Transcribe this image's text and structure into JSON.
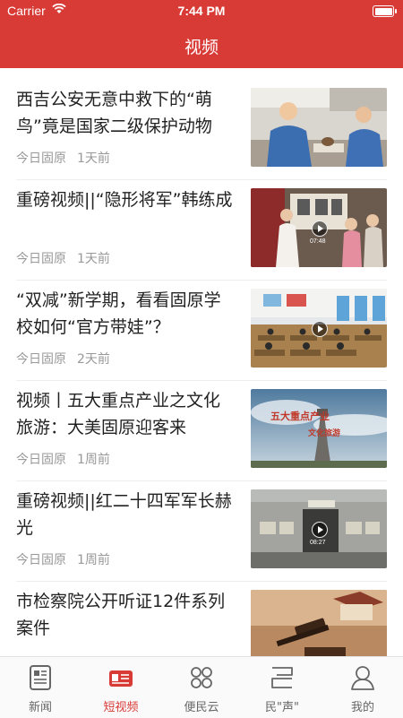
{
  "status": {
    "carrier": "Carrier",
    "time": "7:44 PM"
  },
  "nav": {
    "title": "视频"
  },
  "items": [
    {
      "title": "西吉公安无意中救下的“萌鸟”竟是国家二级保护动物",
      "source": "今日固原",
      "time": "1天前",
      "duration": ""
    },
    {
      "title": "重磅视频||“隐形将军”韩练成",
      "source": "今日固原",
      "time": "1天前",
      "duration": "07:48"
    },
    {
      "title": "“双减”新学期，看看固原学校如何“官方带娃”？",
      "source": "今日固原",
      "time": "2天前",
      "duration": ""
    },
    {
      "title": "视频丨五大重点产业之文化旅游：大美固原迎客来",
      "source": "今日固原",
      "time": "1周前",
      "duration": ""
    },
    {
      "title": "重磅视频||红二十四军军长赫光",
      "source": "今日固原",
      "time": "1周前",
      "duration": "08:27"
    },
    {
      "title": "市检察院公开听证12件系列案件",
      "source": "",
      "time": "",
      "duration": ""
    }
  ],
  "thumb_text": {
    "tourism_big": "五大重点产业",
    "tourism_sub": "文化旅游"
  },
  "tabs": [
    {
      "label": "新闻",
      "icon": "news-icon"
    },
    {
      "label": "短视频",
      "icon": "short-video-icon"
    },
    {
      "label": "便民云",
      "icon": "cloud-services-icon"
    },
    {
      "label": "民\"声\"",
      "icon": "voice-icon"
    },
    {
      "label": "我的",
      "icon": "profile-icon"
    }
  ],
  "active_tab": "短视频",
  "colors": {
    "brand": "#d83a36",
    "text": "#222222",
    "meta": "#999999",
    "tab_inactive": "#666666"
  }
}
